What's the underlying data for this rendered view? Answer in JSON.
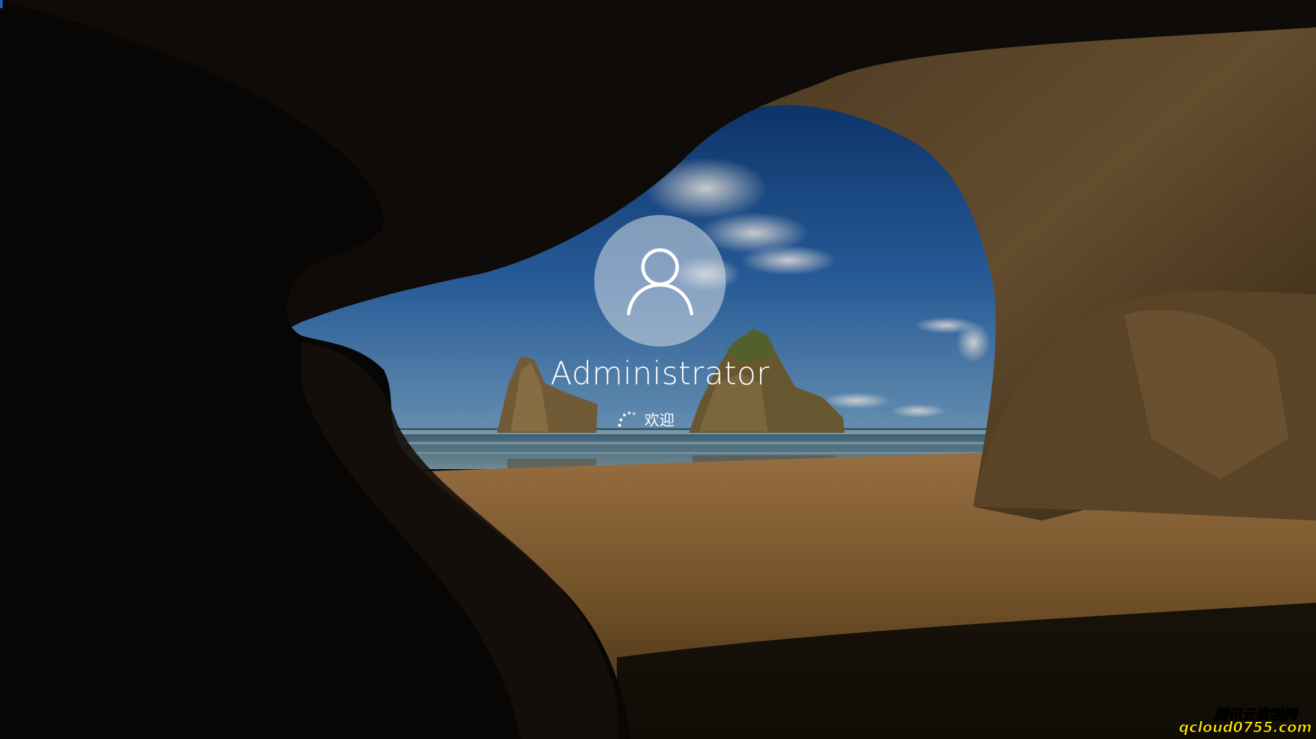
{
  "login": {
    "username": "Administrator",
    "status_text": "欢迎",
    "avatar_icon": "user-icon",
    "spinner_icon": "loading-spinner-icon"
  },
  "watermark": {
    "line1": "腾讯云教程网",
    "line2": "qcloud0755.com",
    "fill_color": "#ffe600",
    "stroke_color": "#000000"
  },
  "colors": {
    "text": "#ffffff",
    "avatar_bg": "#d7dee6",
    "edge_accent": "#1e5fb4"
  }
}
